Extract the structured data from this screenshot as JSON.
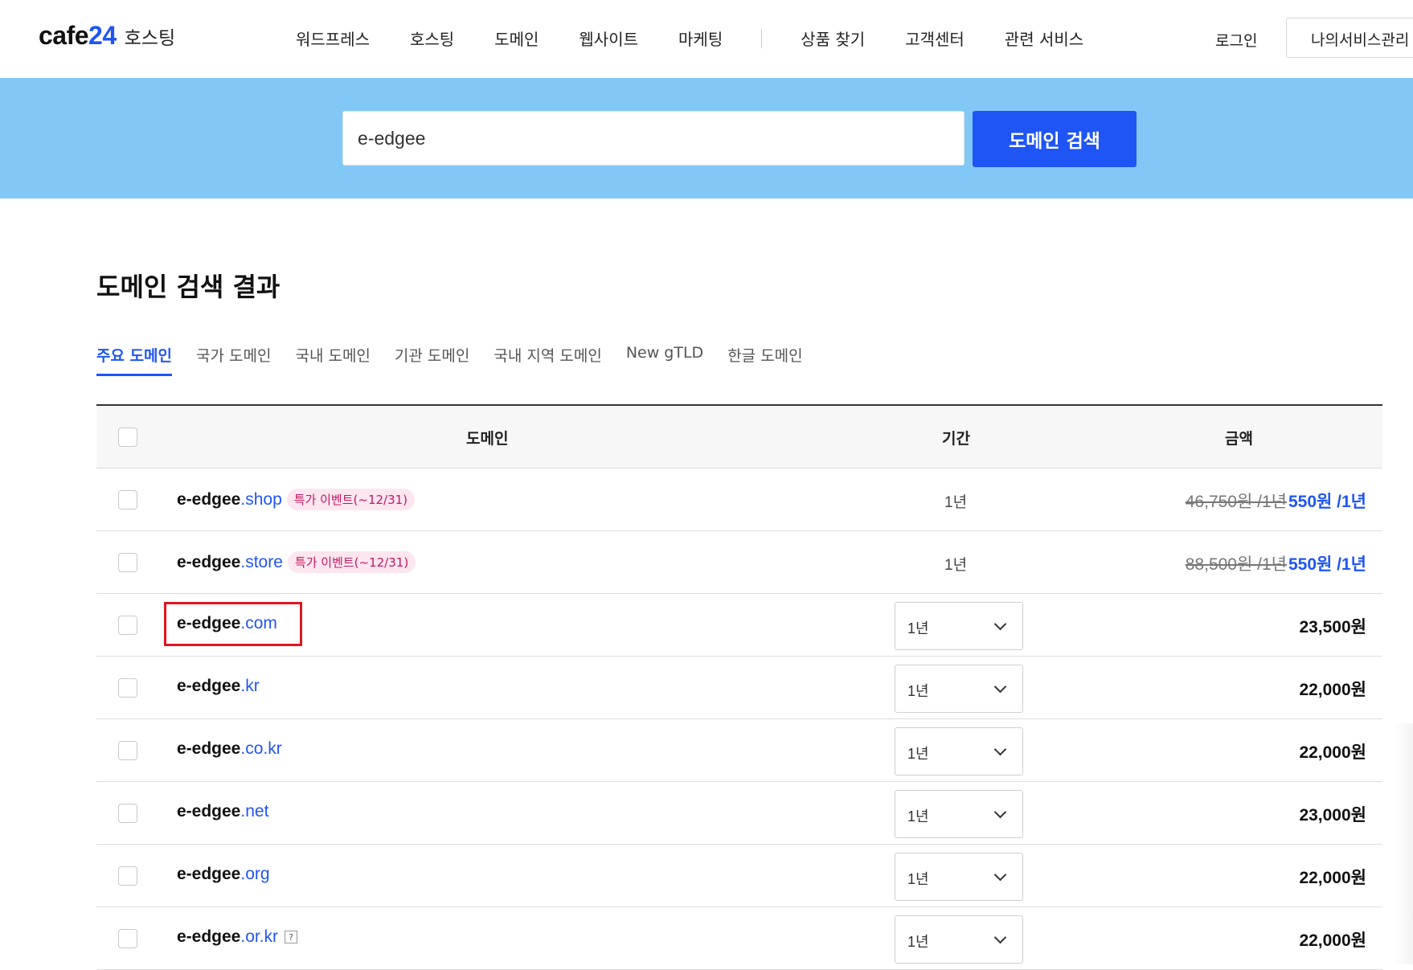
{
  "header": {
    "logo_main": "cafe",
    "logo_num": "24",
    "logo_sub": "호스팅",
    "nav_left": [
      "워드프레스",
      "호스팅",
      "도메인",
      "웹사이트",
      "마케팅"
    ],
    "nav_right": [
      "상품 찾기",
      "고객센터",
      "관련 서비스"
    ],
    "login": "로그인",
    "my_service": "나의서비스관리"
  },
  "search": {
    "value": "e-edgee",
    "button": "도메인 검색"
  },
  "result": {
    "title": "도메인 검색 결과",
    "tabs": [
      "주요 도메인",
      "국가 도메인",
      "국내 도메인",
      "기관 도메인",
      "국내 지역 도메인",
      "New gTLD",
      "한글 도메인"
    ],
    "active_tab": 0
  },
  "table": {
    "headers": {
      "domain": "도메인",
      "period": "기간",
      "price": "금액"
    },
    "rows": [
      {
        "name": "e-edgee",
        "tld": ".shop",
        "badge": "특가 이벤트(~12/31)",
        "period": "1년",
        "price_old": "46,750원 /1년",
        "price_new": "550원 /1년"
      },
      {
        "name": "e-edgee",
        "tld": ".store",
        "badge": "특가 이벤트(~12/31)",
        "period": "1년",
        "price_old": "88,500원 /1년",
        "price_new": "550원 /1년"
      },
      {
        "name": "e-edgee",
        "tld": ".com",
        "period": "1년",
        "price": "23,500원",
        "highlighted": true
      },
      {
        "name": "e-edgee",
        "tld": ".kr",
        "period": "1년",
        "price": "22,000원"
      },
      {
        "name": "e-edgee",
        "tld": ".co.kr",
        "period": "1년",
        "price": "22,000원"
      },
      {
        "name": "e-edgee",
        "tld": ".net",
        "period": "1년",
        "price": "23,000원"
      },
      {
        "name": "e-edgee",
        "tld": ".org",
        "period": "1년",
        "price": "22,000원"
      },
      {
        "name": "e-edgee",
        "tld": ".or.kr",
        "period": "1년",
        "price": "22,000원",
        "help_icon": "?"
      }
    ]
  },
  "colors": {
    "brand_blue": "#1f55f5",
    "search_band": "#82c8f6",
    "badge_bg": "#fde6ef",
    "badge_text": "#c31862",
    "highlight": "#e0161e"
  }
}
